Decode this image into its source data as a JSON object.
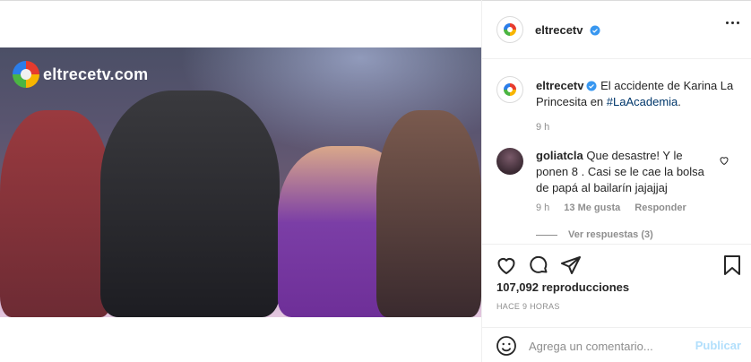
{
  "media": {
    "watermark": "eltrecetv.com",
    "mute_icon": "speaker-muted-icon"
  },
  "post": {
    "username": "eltrecetv",
    "more_icon": "more-options-icon"
  },
  "caption": {
    "username": "eltrecetv",
    "text": "El accidente de Karina La Princesita en",
    "hashtag": "#LaAcademia",
    "suffix": ".",
    "time": "9 h"
  },
  "comment": {
    "username": "goliatcla",
    "text": "Que desastre! Y le ponen 8 . Casi se le cae la bolsa de papá al bailarín jajajjaj",
    "time": "9 h",
    "likes": "13 Me gusta",
    "reply": "Responder",
    "view_replies": "Ver respuestas (3)"
  },
  "actions": {
    "views": "107,092 reproducciones",
    "timestamp": "HACE 9 HORAS"
  },
  "composer": {
    "placeholder": "Agrega un comentario...",
    "post_label": "Publicar"
  },
  "colors": {
    "link": "#00376b",
    "verified": "#3897f0",
    "muted_text": "#8e8e8e",
    "post_disabled": "#b2dffc"
  }
}
